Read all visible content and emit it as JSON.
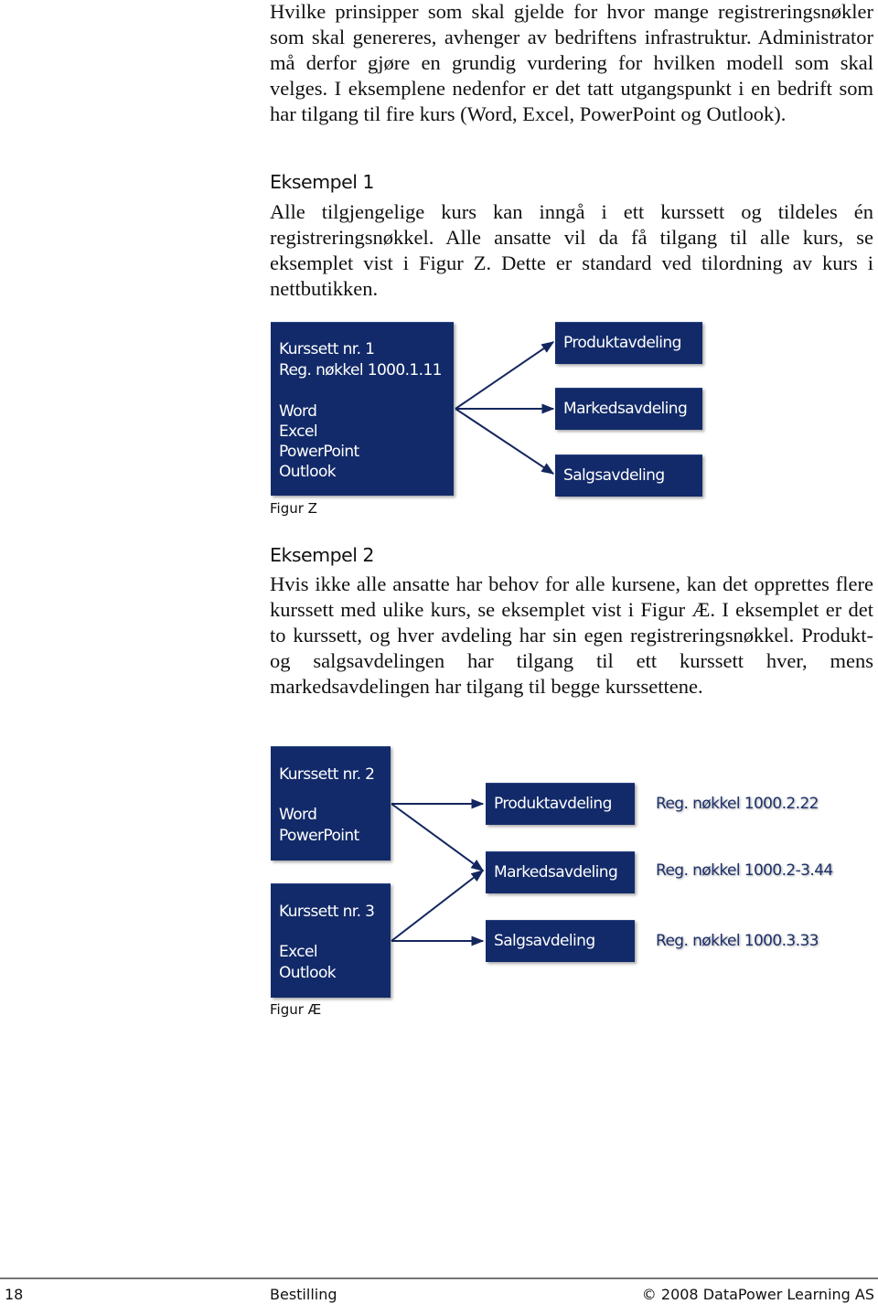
{
  "intro": {
    "lines": [
      "Hvilke prinsipper som skal gjelde for hvor mange registreringsnøkler som skal genereres, avhenger av bedriftens infrastruktur. Administrator må derfor gjøre en grundig vurdering for hvilken modell som skal velges. I eksemplene nedenfor er det tatt utgangspunkt i en bedrift som har tilgang til fire kurs (Word, Excel, PowerPoint og Outlook)."
    ]
  },
  "example1": {
    "heading": "Eksempel 1",
    "text": "Alle tilgjengelige kurs kan inngå i ett kurssett og tildeles én registreringsnøkkel. Alle ansatte vil da få tilgang til alle kurs, se eksemplet vist i Figur Z. Dette er standard ved tilordning av kurs i nettbutikken.",
    "figure": {
      "caption": "Figur Z",
      "course_set": {
        "title": "Kurssett nr. 1",
        "key": "Reg. nøkkel 1000.1.11",
        "courses": [
          "Word",
          "Excel",
          "PowerPoint",
          "Outlook"
        ]
      },
      "departments": [
        "Produktavdeling",
        "Markedsavdeling",
        "Salgsavdeling"
      ]
    }
  },
  "example2": {
    "heading": "Eksempel 2",
    "text": "Hvis ikke alle ansatte har behov for alle kursene, kan det opprettes flere kurssett med ulike kurs, se eksemplet vist i Figur Æ. I eksemplet er det to kurssett, og hver avdeling har sin egen registreringsnøkkel. Produkt- og salgsavdelingen har tilgang til ett kurssett hver, mens markedsavdelingen har tilgang til begge kurssettene.",
    "figure": {
      "caption": "Figur Æ",
      "course_sets": [
        {
          "title": "Kurssett nr. 2",
          "courses": [
            "Word",
            "PowerPoint"
          ]
        },
        {
          "title": "Kurssett nr. 3",
          "courses": [
            "Excel",
            "Outlook"
          ]
        }
      ],
      "departments": [
        {
          "name": "Produktavdeling",
          "key": "Reg. nøkkel 1000.2.22"
        },
        {
          "name": "Markedsavdeling",
          "key": "Reg. nøkkel 1000.2-3.44"
        },
        {
          "name": "Salgsavdeling",
          "key": "Reg. nøkkel 1000.3.33"
        }
      ]
    }
  },
  "footer": {
    "page_number": "18",
    "section": "Bestilling",
    "copyright": "© 2008 DataPower Learning AS"
  },
  "colors": {
    "box_fill": "#122a69",
    "arrow": "#14265e",
    "key_text": "#1c2f68"
  }
}
